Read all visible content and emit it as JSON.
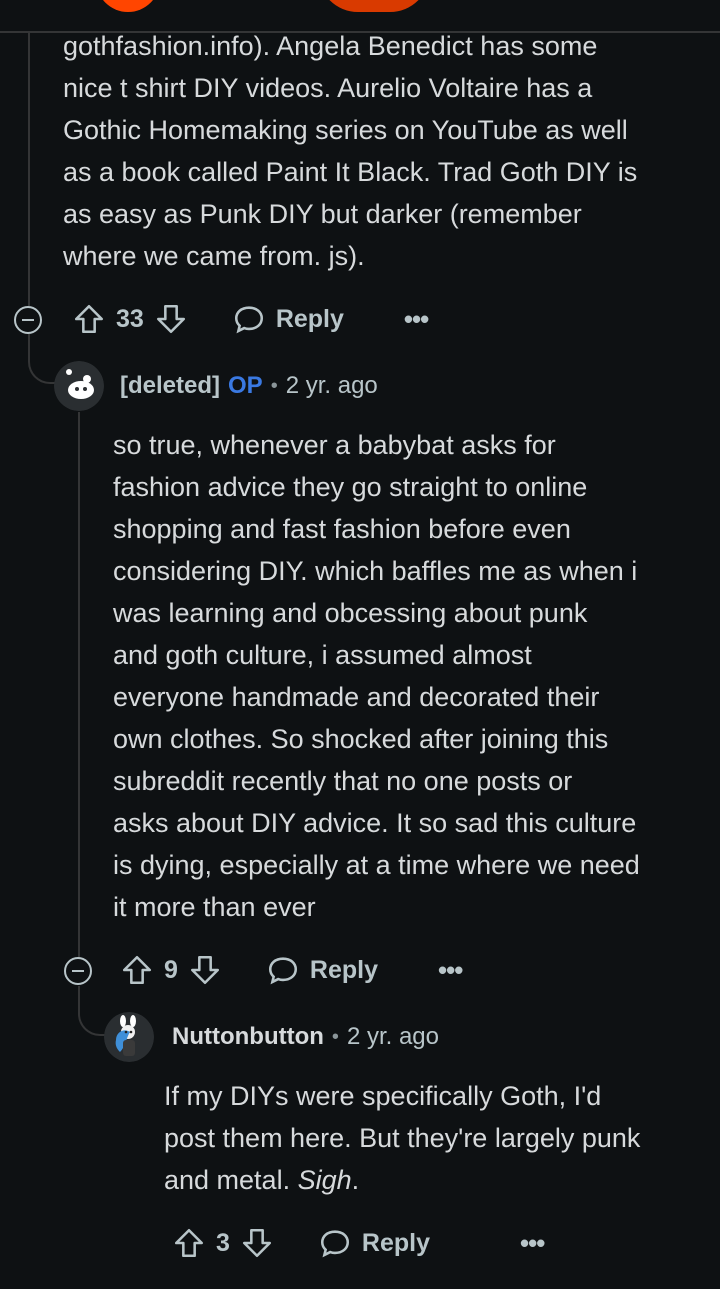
{
  "top_comment": {
    "lines": [
      "gothfashion.info). Angela Benedict has some",
      "nice t shirt DIY videos. Aurelio Voltaire has a",
      "Gothic Homemaking series on YouTube as well",
      "as a book called Paint It Black. Trad Goth DIY is",
      "as easy as Punk DIY but darker (remember",
      "where we came from. js)."
    ],
    "score": "33",
    "reply_label": "Reply",
    "more_label": "•••"
  },
  "op_comment": {
    "author": "[deleted]",
    "op_badge": "OP",
    "separator": "•",
    "time": "2 yr. ago",
    "lines": [
      "so true, whenever a babybat asks for",
      "fashion advice they go straight to online",
      "shopping and fast fashion before even",
      "considering DIY. which baffles me as when i",
      "was learning and obcessing about punk",
      "and goth culture, i assumed almost",
      "everyone handmade and decorated their",
      "own clothes. So shocked after joining this",
      "subreddit recently that no one posts or",
      "asks about DIY advice. It so sad this culture",
      "is dying, especially at a time where we need",
      "it more than ever"
    ],
    "score": "9",
    "reply_label": "Reply",
    "more_label": "•••"
  },
  "reply_comment": {
    "author": "Nuttonbutton",
    "separator": "•",
    "time": "2 yr. ago",
    "line1": "If my DIYs were specifically Goth, I'd",
    "line2": "post them here. But they're largely punk",
    "line3_prefix": "and metal. ",
    "line3_italic": "Sigh",
    "line3_suffix": ".",
    "score": "3",
    "reply_label": "Reply",
    "more_label": "•••"
  },
  "colors": {
    "background": "#0e1113",
    "text": "#d7dadc",
    "muted": "#b8c5c9",
    "op_blue": "#3a79e2",
    "line": "#343536"
  }
}
